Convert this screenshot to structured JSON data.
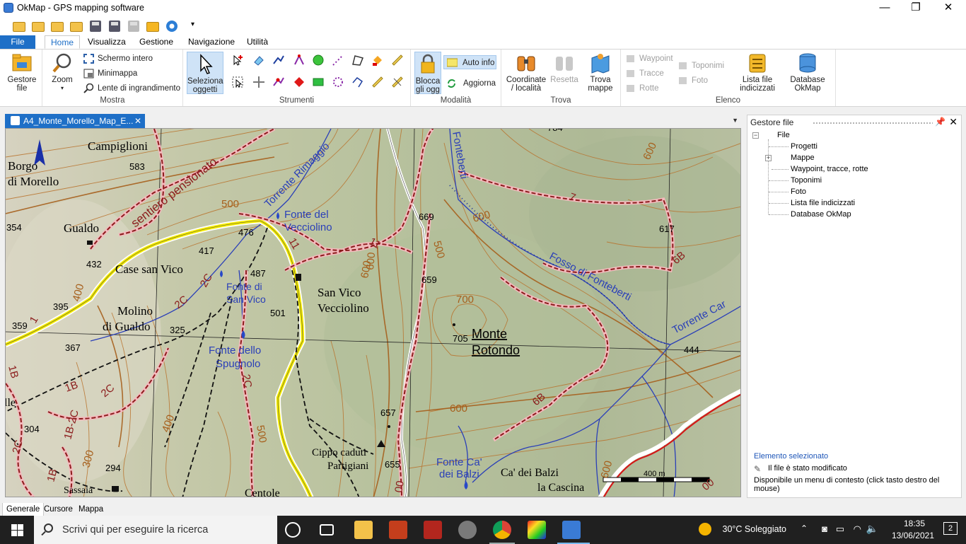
{
  "window": {
    "title": "OkMap - GPS mapping software",
    "controls": [
      "—",
      "❐",
      "✕"
    ]
  },
  "ribbon_tabs": [
    "File",
    "Home",
    "Visualizza",
    "Gestione",
    "Navigazione",
    "Utilità"
  ],
  "ribbon": {
    "gestore_file": {
      "label1": "Gestore",
      "label2": "file"
    },
    "mostra": {
      "zoom": "Zoom",
      "schermo_intero": "Schermo intero",
      "minimappa": "Minimappa",
      "lente": "Lente di ingrandimento",
      "group": "Mostra"
    },
    "strumenti": {
      "seleziona1": "Seleziona",
      "seleziona2": "oggetti",
      "group": "Strumenti"
    },
    "modalita": {
      "blocca1": "Blocca",
      "blocca2": "gli ogg",
      "auto_info": "Auto info",
      "aggiorna": "Aggiorna",
      "group": "Modalità"
    },
    "trova": {
      "coordinate1": "Coordinate",
      "coordinate2": "/ località",
      "resetta": "Resetta",
      "trova_mappe1": "Trova",
      "trova_mappe2": "mappe",
      "group": "Trova"
    },
    "elenco": {
      "waypoint": "Waypoint",
      "tracce": "Tracce",
      "rotte": "Rotte",
      "toponimi": "Toponimi",
      "foto": "Foto",
      "lista1": "Lista file",
      "lista2": "indicizzati",
      "database1": "Database",
      "database2": "OkMap",
      "group": "Elenco"
    }
  },
  "document_tab": {
    "title": "A4_Monte_Morello_Map_E..."
  },
  "map": {
    "labels": {
      "campiglioni": "Campiglioni",
      "borgo": "Borgo",
      "di_morello": "di Morello",
      "gualdo": "Gualdo",
      "case_san_vico": "Case san Vico",
      "molino": "Molino",
      "di_gualdo": "di Gualdo",
      "fonte_del": "Fonte del",
      "vecciolino": "Vecciolino",
      "fonte_di": "Fonte di",
      "san_vico": "San Vico",
      "san_vico2": "San Vico",
      "vecciolino2": "Vecciolino",
      "fonte_dello": "Fonte dello",
      "spugnolo": "Spugnolo",
      "monte": "Monte",
      "rotondo": "Rotondo",
      "cippo": "Cippo caduti",
      "partigiani": "Partigiani",
      "fonte_ca": "Fonte Ca'",
      "dei_balzi": "dei Balzi",
      "ca_dei_balzi": "Ca' dei Balzi",
      "la_cascina": "la Cascina",
      "centole": "Centole",
      "sassaia": "Sassaia",
      "le": "lle",
      "sentiero": "sentiero pensionato",
      "torrente_rimaggio": "Torrente Rimaggio",
      "fosso": "Fosso di Fonteberti",
      "torrente_car": "Torrente Car",
      "fonteberti": "Fonteberti"
    },
    "elevations": {
      "e583": "583",
      "e354": "354",
      "e432": "432",
      "e476": "476",
      "e417": "417",
      "e487": "487",
      "e501": "501",
      "e395": "395",
      "e359": "359",
      "e325": "325",
      "e367": "367",
      "e304": "304",
      "e294": "294",
      "e669": "669",
      "e659": "659",
      "e705": "705",
      "e657": "657",
      "e655": "655",
      "e617": "617",
      "e444": "444",
      "e784": "784"
    },
    "contours": {
      "c500": "500",
      "c600a": "600",
      "c600b": "600",
      "c600c": "600",
      "c700": "700",
      "c600d": "600",
      "c400a": "400",
      "c400b": "400",
      "c300": "300",
      "c500b": "500",
      "c600e": "600",
      "c500c": "500",
      "c600f": "600"
    },
    "trail_labels": {
      "t1": "1",
      "t11a": "11",
      "t11b": "11",
      "t7": "7",
      "t6b": "6B",
      "t6b2": "6B",
      "t2c": "2C",
      "t2c2": "2C",
      "t2c3": "2C",
      "t1b": "1B",
      "t1b2": "1B",
      "t1b2c": "1B-2C",
      "t1b3": "1B",
      "t2c4": "2C",
      "t2c5": "2C",
      "t00": "00",
      "t00b": "00"
    },
    "scale": "400 m"
  },
  "panel": {
    "title": "Gestore file",
    "tree": {
      "root": "File",
      "items": [
        "Progetti",
        "Mappe",
        "Waypoint, tracce, rotte",
        "Toponimi",
        "Foto",
        "Lista file indicizzati",
        "Database OkMap"
      ]
    },
    "selected_title": "Elemento selezionato",
    "selected_status": "Il file è stato modificato",
    "selected_desc": "Disponibile un menu di contesto (click tasto destro del mouse)"
  },
  "bottom_tabs": [
    "Generale",
    "Cursore",
    "Mappa"
  ],
  "taskbar": {
    "search_placeholder": "Scrivi qui per eseguire la ricerca",
    "weather": "30°C  Soleggiato",
    "time": "18:35",
    "date": "13/06/2021",
    "notifications": "2"
  },
  "colors": {
    "accent": "#1e6fc7",
    "trail": "#8b1c1c",
    "road": "#f5ec00",
    "water": "#2a3fb8",
    "contour": "#b9722c"
  }
}
